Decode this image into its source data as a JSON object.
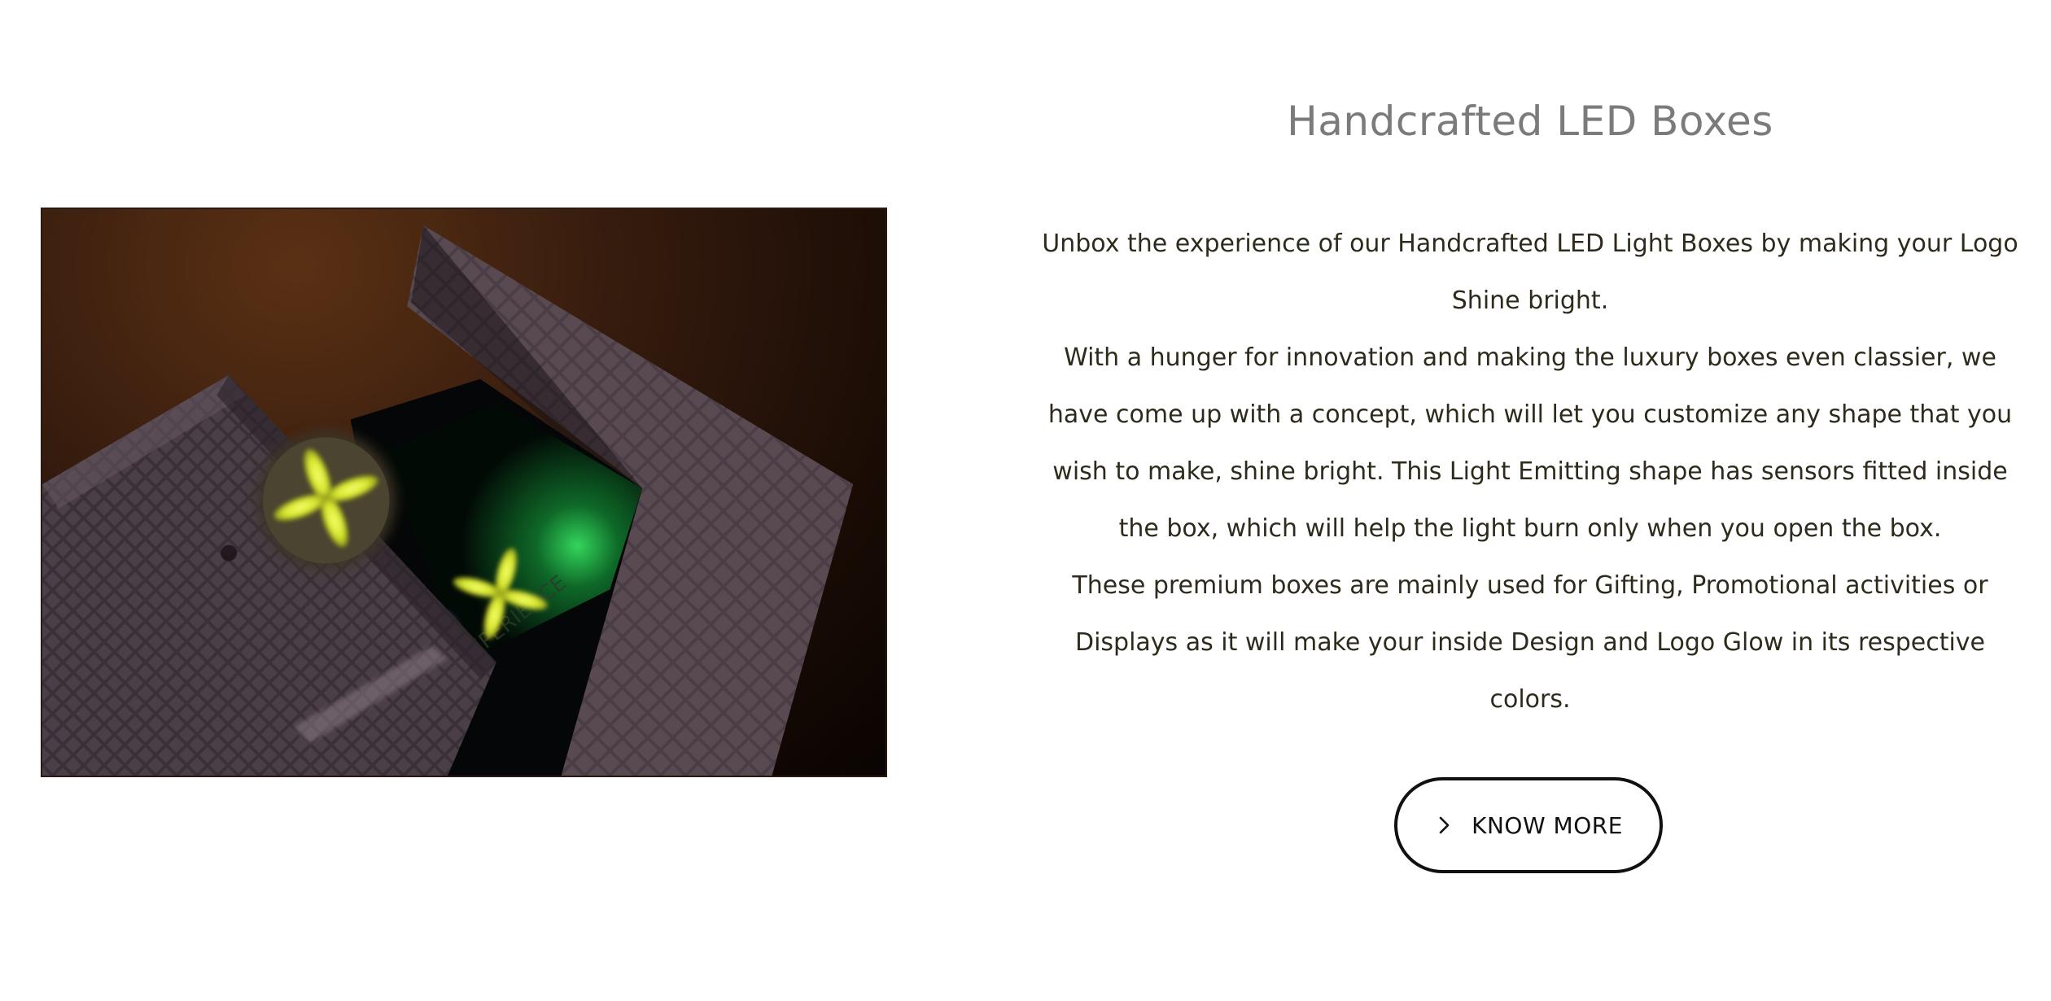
{
  "section": {
    "title": "Handcrafted LED Boxes",
    "paragraphs": [
      "Unbox the experience of our Handcrafted LED Light Boxes by making your Logo Shine bright.",
      "With a hunger for innovation and making the luxury boxes even classier, we have come up with a concept, which will let you customize any shape that you wish to make, shine bright. This Light Emitting shape has sensors fitted inside the box, which will help the light burn only when you open the box.",
      "These premium boxes are mainly used for Gifting, Promotional activities or Displays as it will make your inside Design and Logo Glow in its respective colors."
    ],
    "button_label": "KNOW MORE",
    "button_icon": "chevron-right-icon",
    "image_inner_text": "EXPERIENCE"
  },
  "colors": {
    "title": "#7b7b7b",
    "body": "#2e2b1c",
    "button_border": "#111111",
    "glow_yellow": "#d9e832",
    "glow_green": "#2fd25a"
  }
}
